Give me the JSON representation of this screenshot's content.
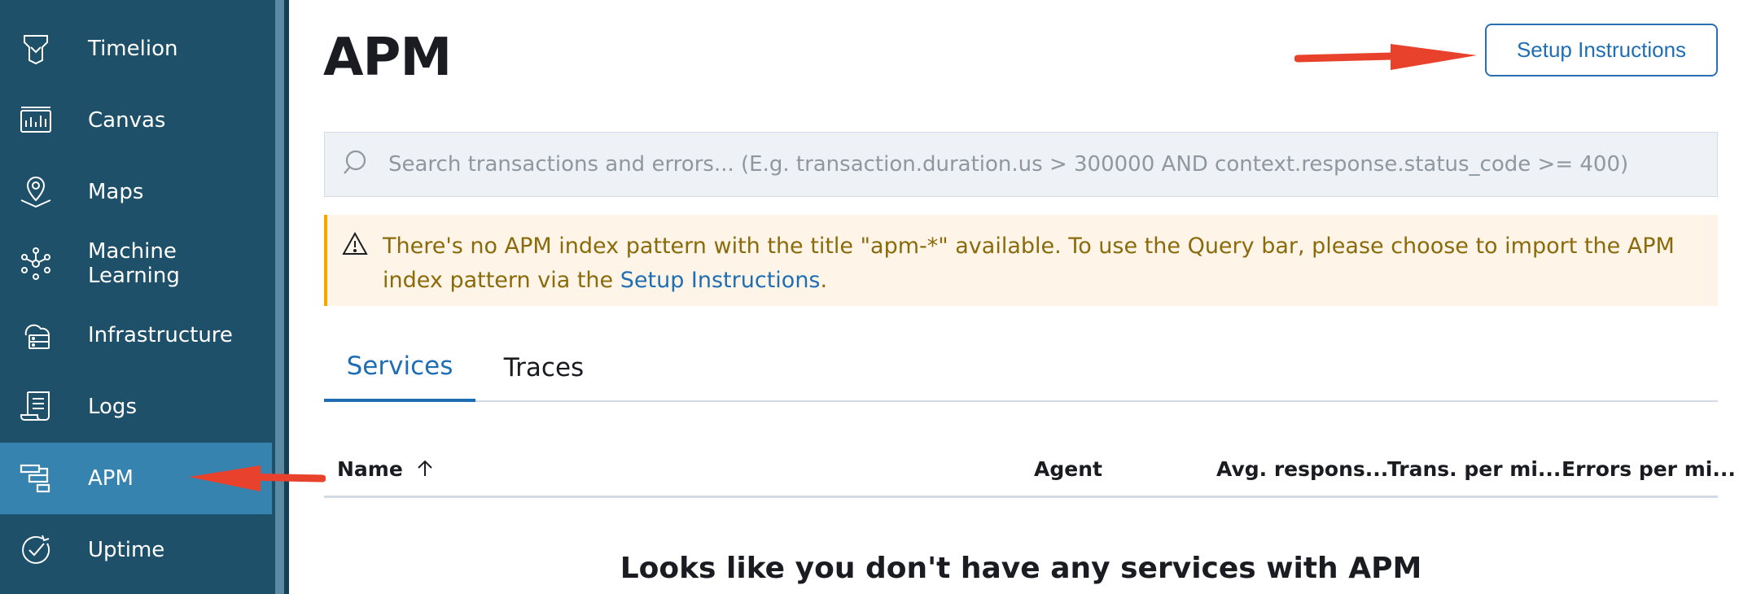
{
  "sidebar": {
    "items": [
      {
        "label": "Timelion",
        "icon": "timelion-icon"
      },
      {
        "label": "Canvas",
        "icon": "canvas-icon"
      },
      {
        "label": "Maps",
        "icon": "maps-icon"
      },
      {
        "label": "Machine Learning",
        "icon": "machine-learning-icon"
      },
      {
        "label": "Infrastructure",
        "icon": "infrastructure-icon"
      },
      {
        "label": "Logs",
        "icon": "logs-icon"
      },
      {
        "label": "APM",
        "icon": "apm-icon",
        "active": true
      },
      {
        "label": "Uptime",
        "icon": "uptime-icon"
      }
    ]
  },
  "header": {
    "title": "APM",
    "setup_button": "Setup Instructions"
  },
  "search": {
    "placeholder": "Search transactions and errors... (E.g. transaction.duration.us > 300000 AND context.response.status_code >= 400)",
    "value": ""
  },
  "callout": {
    "text_before": "There's no APM index pattern with the title \"apm-*\" available. To use the Query bar, please choose to import the APM index pattern via the ",
    "link": "Setup Instructions",
    "text_after": "."
  },
  "tabs": [
    {
      "label": "Services",
      "active": true
    },
    {
      "label": "Traces",
      "active": false
    }
  ],
  "table": {
    "columns": [
      "Name",
      "Agent",
      "Avg. respons...",
      "Trans. per mi...",
      "Errors per mi..."
    ]
  },
  "empty_state": {
    "title": "Looks like you don't have any services with APM"
  },
  "colors": {
    "sidebar_bg": "#1e5069",
    "active_item": "#3583ae",
    "accent": "#1f6eb4",
    "warning_bg": "#fef5e8",
    "warning_text": "#8a6a0a",
    "annotation_arrow": "#e8412c"
  }
}
